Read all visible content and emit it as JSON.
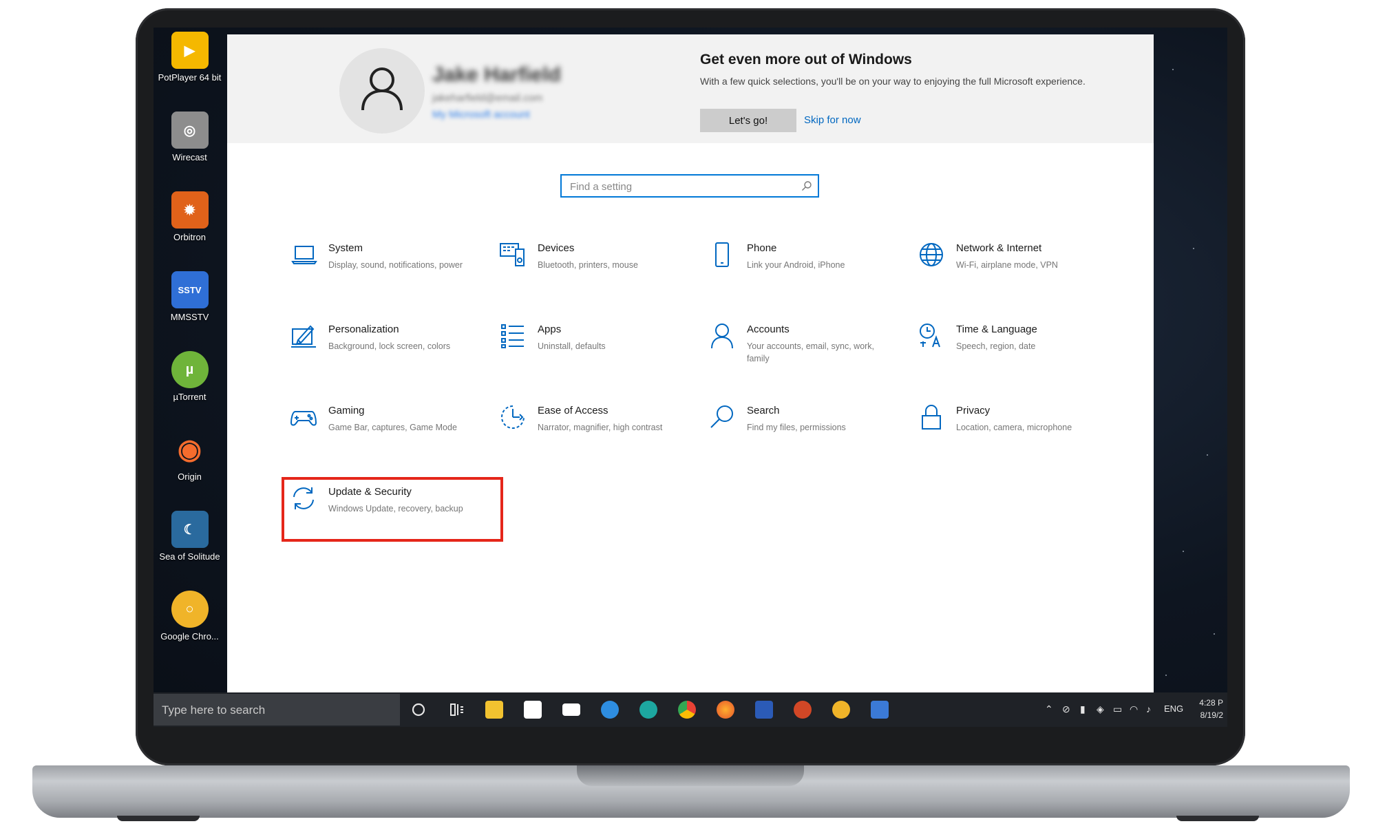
{
  "desktop": {
    "icons": [
      {
        "label": "PotPlayer 64 bit",
        "color": "#f5b800"
      },
      {
        "label": "Wirecast",
        "color": "#9a9a9a"
      },
      {
        "label": "Orbitron",
        "color": "#f07b17"
      },
      {
        "label": "MMSSTV",
        "color": "#2f6fd6"
      },
      {
        "label": "µTorrent",
        "color": "#6fb43a"
      },
      {
        "label": "Origin",
        "color": "#f56c2d"
      },
      {
        "label": "Sea of Solitude",
        "color": "#2a6a9e"
      },
      {
        "label": "Google Chro...",
        "color": "#f0b429"
      }
    ]
  },
  "header": {
    "user_name": "Jake Harfield",
    "user_email": "jakeharfield@email.com",
    "user_link": "My Microsoft account",
    "promo_title": "Get even more out of Windows",
    "promo_text": "With a few quick selections, you'll be on your way to enjoying the full Microsoft experience.",
    "lets_go_label": "Let's go!",
    "skip_label": "Skip for now"
  },
  "search": {
    "placeholder": "Find a setting"
  },
  "tiles": [
    {
      "title": "System",
      "desc": "Display, sound, notifications, power",
      "icon": "laptop-icon"
    },
    {
      "title": "Devices",
      "desc": "Bluetooth, printers, mouse",
      "icon": "devices-icon"
    },
    {
      "title": "Phone",
      "desc": "Link your Android, iPhone",
      "icon": "phone-icon"
    },
    {
      "title": "Network & Internet",
      "desc": "Wi-Fi, airplane mode, VPN",
      "icon": "globe-icon"
    },
    {
      "title": "Personalization",
      "desc": "Background, lock screen, colors",
      "icon": "paint-icon"
    },
    {
      "title": "Apps",
      "desc": "Uninstall, defaults",
      "icon": "apps-list-icon"
    },
    {
      "title": "Accounts",
      "desc": "Your accounts, email, sync, work, family",
      "icon": "person-icon"
    },
    {
      "title": "Time & Language",
      "desc": "Speech, region, date",
      "icon": "time-language-icon"
    },
    {
      "title": "Gaming",
      "desc": "Game Bar, captures, Game Mode",
      "icon": "gamepad-icon"
    },
    {
      "title": "Ease of Access",
      "desc": "Narrator, magnifier, high contrast",
      "icon": "ease-of-access-icon"
    },
    {
      "title": "Search",
      "desc": "Find my files, permissions",
      "icon": "search-icon"
    },
    {
      "title": "Privacy",
      "desc": "Location, camera, microphone",
      "icon": "lock-icon"
    },
    {
      "title": "Update & Security",
      "desc": "Windows Update, recovery, backup",
      "icon": "sync-icon"
    }
  ],
  "taskbar": {
    "search_placeholder": "Type here to search",
    "language": "ENG",
    "time": "4:28 P",
    "date": "8/19/2"
  },
  "colors": {
    "accent": "#0078d7",
    "highlight": "#e5261a"
  }
}
